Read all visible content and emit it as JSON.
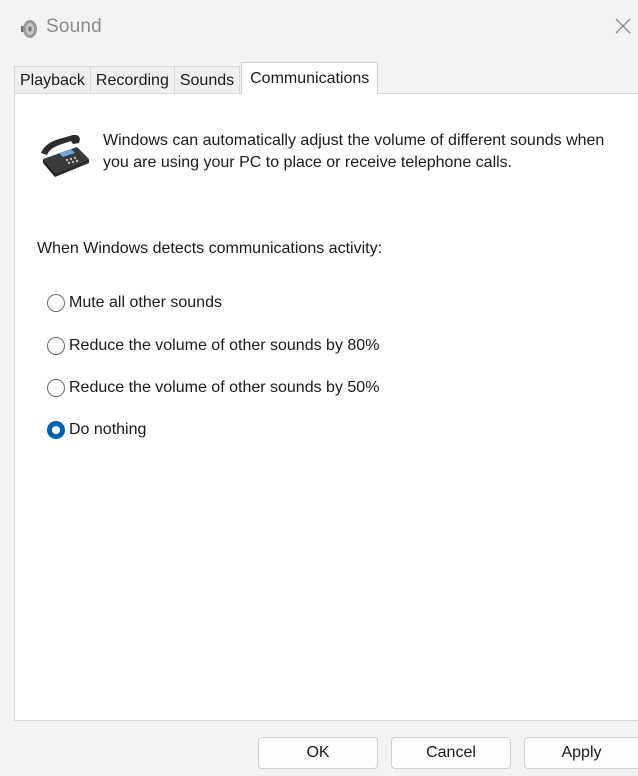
{
  "window": {
    "title": "Sound"
  },
  "tabs": [
    {
      "label": "Playback",
      "active": false
    },
    {
      "label": "Recording",
      "active": false
    },
    {
      "label": "Sounds",
      "active": false
    },
    {
      "label": "Communications",
      "active": true
    }
  ],
  "communications": {
    "description": "Windows can automatically adjust the volume of different sounds when you are using your PC to place or receive telephone calls.",
    "section_label": "When Windows detects communications activity:",
    "options": [
      {
        "label": "Mute all other sounds",
        "selected": false
      },
      {
        "label": "Reduce the volume of other sounds by 80%",
        "selected": false
      },
      {
        "label": "Reduce the volume of other sounds by 50%",
        "selected": false
      },
      {
        "label": "Do nothing",
        "selected": true
      }
    ]
  },
  "footer": {
    "ok_label": "OK",
    "cancel_label": "Cancel",
    "apply_label": "Apply"
  },
  "colors": {
    "accent": "#0063b1",
    "window_bg": "#f3f3f3",
    "panel_bg": "#ffffff"
  },
  "icons": {
    "title": "speaker-icon",
    "description": "telephone-icon",
    "close": "close-icon"
  }
}
